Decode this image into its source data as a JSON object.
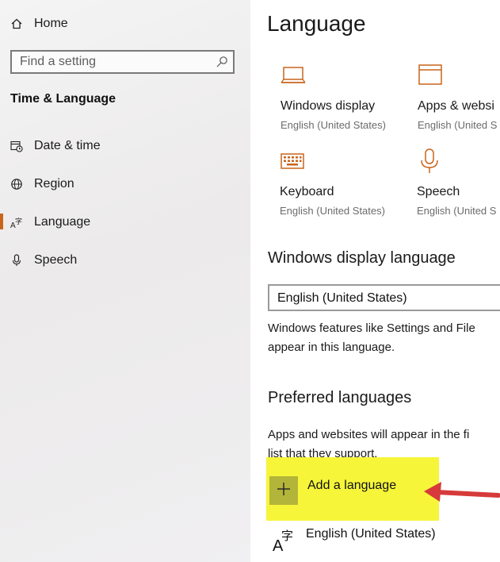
{
  "sidebar": {
    "home_label": "Home",
    "search_placeholder": "Find a setting",
    "section_title": "Time & Language",
    "items": [
      {
        "label": "Date & time",
        "icon": "calendar-clock-icon"
      },
      {
        "label": "Region",
        "icon": "globe-icon"
      },
      {
        "label": "Language",
        "icon": "language-icon",
        "active": true
      },
      {
        "label": "Speech",
        "icon": "microphone-icon"
      }
    ]
  },
  "main": {
    "title": "Language",
    "tiles": [
      {
        "name": "Windows display",
        "sub": "English (United States)",
        "icon": "laptop-icon"
      },
      {
        "name": "Apps & websi",
        "sub": "English (United S",
        "icon": "app-window-icon"
      },
      {
        "name": "Keyboard",
        "sub": "English (United States)",
        "icon": "keyboard-icon"
      },
      {
        "name": "Speech",
        "sub": "English (United S",
        "icon": "microphone-icon"
      }
    ],
    "display_language": {
      "heading": "Windows display language",
      "selected": "English (United States)",
      "desc_line1": "Windows features like Settings and File",
      "desc_line2": "appear in this language."
    },
    "preferred": {
      "heading": "Preferred languages",
      "desc_line1": "Apps and websites will appear in the fi",
      "desc_line2": "list that they support.",
      "add_label": "Add a language",
      "languages": [
        {
          "name": "English (United States)"
        }
      ]
    }
  },
  "colors": {
    "accent": "#c8651b",
    "highlight": "#f6f53a",
    "add_button": "#b3b43a",
    "arrow": "#d63a3a"
  }
}
